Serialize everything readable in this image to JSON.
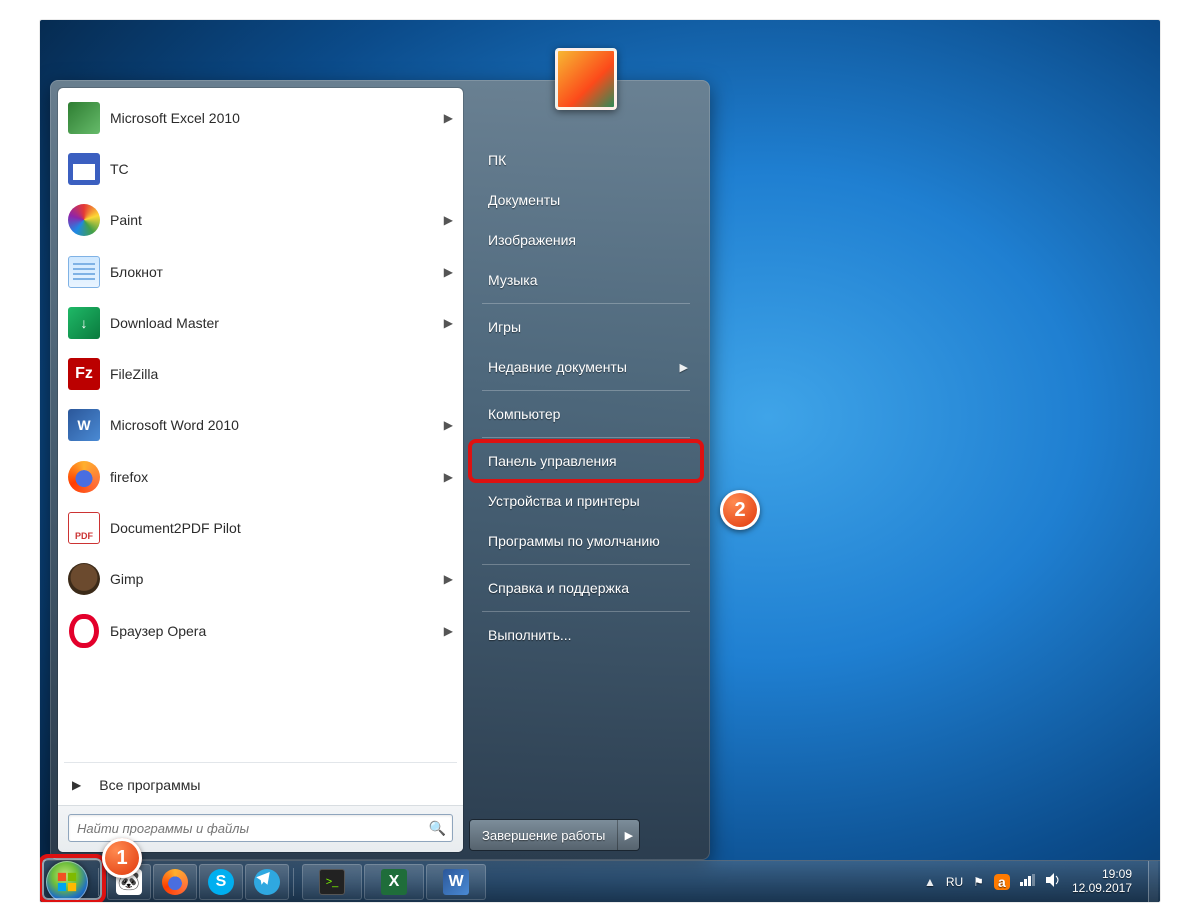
{
  "start_menu": {
    "programs": [
      {
        "label": "Microsoft Excel 2010",
        "icon": "i-excel",
        "submenu": true
      },
      {
        "label": "TC",
        "icon": "i-tc",
        "submenu": false
      },
      {
        "label": "Paint",
        "icon": "i-paint",
        "submenu": true
      },
      {
        "label": "Блокнот",
        "icon": "i-notepad",
        "submenu": true
      },
      {
        "label": "Download Master",
        "icon": "i-dm",
        "submenu": true
      },
      {
        "label": "FileZilla",
        "icon": "i-fz",
        "submenu": false,
        "glyph": "Fz"
      },
      {
        "label": "Microsoft Word 2010",
        "icon": "i-word",
        "submenu": true,
        "glyph": "W"
      },
      {
        "label": "firefox",
        "icon": "i-ff",
        "submenu": true
      },
      {
        "label": "Document2PDF Pilot",
        "icon": "i-pdf",
        "submenu": false
      },
      {
        "label": "Gimp",
        "icon": "i-gimp",
        "submenu": true
      },
      {
        "label": "Браузер Opera",
        "icon": "i-opera",
        "submenu": true
      }
    ],
    "all_programs_label": "Все программы",
    "search_placeholder": "Найти программы и файлы",
    "right_items": [
      {
        "label": "ПК",
        "sep_after": false
      },
      {
        "label": "Документы",
        "sep_after": false
      },
      {
        "label": "Изображения",
        "sep_after": false
      },
      {
        "label": "Музыка",
        "sep_after": true
      },
      {
        "label": "Игры",
        "sep_after": false
      },
      {
        "label": "Недавние документы",
        "submenu": true,
        "sep_after": true
      },
      {
        "label": "Компьютер",
        "sep_after": true
      },
      {
        "label": "Панель управления",
        "sep_after": false,
        "highlight": true
      },
      {
        "label": "Устройства и принтеры",
        "sep_after": false
      },
      {
        "label": "Программы по умолчанию",
        "sep_after": true
      },
      {
        "label": "Справка и поддержка",
        "sep_after": true
      },
      {
        "label": "Выполнить...",
        "sep_after": false
      }
    ],
    "shutdown_label": "Завершение работы"
  },
  "taskbar": {
    "pinned": [
      {
        "name": "panda",
        "icon": "i-panda"
      },
      {
        "name": "firefox",
        "icon": "i-ff"
      },
      {
        "name": "skype",
        "icon": "i-skype",
        "glyph": "S"
      },
      {
        "name": "telegram",
        "icon": "i-tg"
      }
    ],
    "running": [
      {
        "name": "cmd",
        "icon": "i-cmd"
      },
      {
        "name": "excel",
        "icon": "i-excel2",
        "glyph": "X"
      },
      {
        "name": "word",
        "icon": "i-word",
        "glyph": "W"
      }
    ],
    "tray": {
      "lang": "RU",
      "time": "19:09",
      "date": "12.09.2017"
    }
  },
  "annotations": {
    "badge1": "1",
    "badge2": "2"
  }
}
